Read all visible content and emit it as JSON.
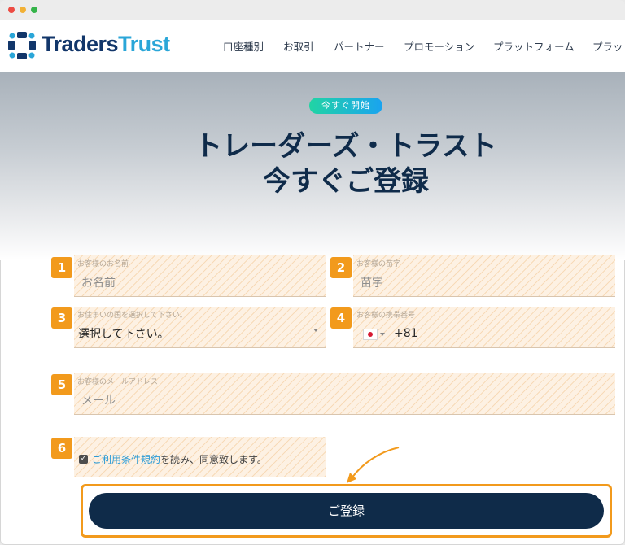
{
  "brand": {
    "logo_text_1": "Traders",
    "logo_text_2": "Trust"
  },
  "nav": {
    "items": [
      "口座種別",
      "お取引",
      "パートナー",
      "プロモーション",
      "プラットフォーム",
      "プラッ"
    ]
  },
  "hero": {
    "badge": "今すぐ開始",
    "title_line1": "トレーダーズ・トラスト",
    "title_line2": "今すぐご登録"
  },
  "form": {
    "first_name": {
      "step": "1",
      "label": "お客様のお名前",
      "placeholder": "お名前"
    },
    "last_name": {
      "step": "2",
      "label": "お客様の苗字",
      "placeholder": "苗字"
    },
    "country": {
      "step": "3",
      "label": "お住まいの国を選択して下さい。",
      "value": "選択して下さい。"
    },
    "phone": {
      "step": "4",
      "label": "お客様の携帯番号",
      "dial_code": "+81"
    },
    "email": {
      "step": "5",
      "label": "お客様のメールアドレス",
      "placeholder": "メール"
    },
    "terms": {
      "step": "6",
      "link_text": "ご利用条件規約",
      "text": "を読み、同意致します。",
      "checked": true
    },
    "submit_label": "ご登録"
  },
  "colors": {
    "accent": "#f29a1c",
    "navy": "#0f2b49",
    "link": "#2b9bd6"
  }
}
